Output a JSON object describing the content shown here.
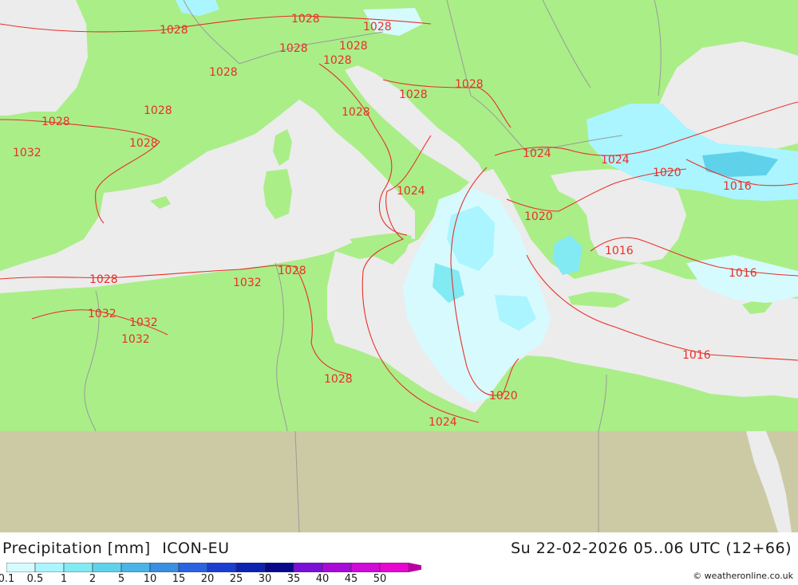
{
  "header": {
    "parameter": "Precipitation [mm]",
    "model": "ICON-EU",
    "datetime": "Su 22-02-2026 05..06 UTC (12+66)",
    "credit": "© weatheronline.co.uk"
  },
  "legend": {
    "labels": [
      "0.1",
      "0.5",
      "1",
      "2",
      "5",
      "10",
      "15",
      "20",
      "25",
      "30",
      "35",
      "40",
      "45",
      "50"
    ],
    "colors": [
      "#d6fbff",
      "#aaf5ff",
      "#82eaf2",
      "#5fd2ea",
      "#4ab4e6",
      "#3a8fe0",
      "#2b63e0",
      "#1b3ed0",
      "#0d22b0",
      "#08098a",
      "#7a10d8",
      "#a80ad8",
      "#d00ad8",
      "#e806d0",
      "#b800a0"
    ]
  },
  "colors": {
    "land": "#aaee88",
    "sea": "#ececec",
    "nodata": "#cccaa5",
    "isobar": "#e8302a",
    "border": "#9a9a9a"
  },
  "isobar_labels": [
    "1028",
    "1028",
    "1028",
    "1028",
    "1028",
    "1028",
    "1028",
    "1028",
    "1028",
    "1028",
    "1028",
    "1028",
    "1028",
    "1028",
    "1028",
    "1032",
    "1032",
    "1032",
    "1032",
    "1032",
    "1024",
    "1024",
    "1024",
    "1024",
    "1020",
    "1020",
    "1020",
    "1016",
    "1016",
    "1016"
  ]
}
